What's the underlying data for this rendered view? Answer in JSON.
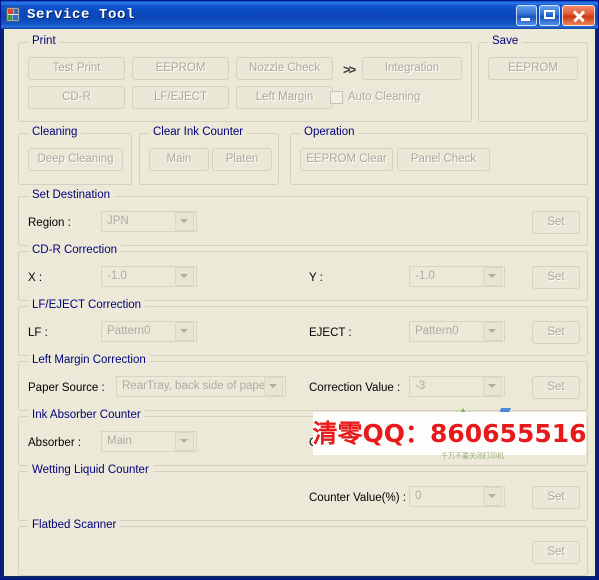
{
  "window": {
    "title": "Service Tool",
    "icon": "printer-app-icon",
    "buttons": {
      "minimize": "minimize-button",
      "maximize": "maximize-button",
      "close": "close-button"
    }
  },
  "groups": {
    "print": {
      "label": "Print",
      "buttons": [
        {
          "label": "Test Print"
        },
        {
          "label": "EEPROM"
        },
        {
          "label": "Nozzle Check"
        },
        {
          "label": "Integration"
        },
        {
          "label": "CD-R"
        },
        {
          "label": "LF/EJECT"
        },
        {
          "label": "Left Margin"
        }
      ],
      "separator": ">>",
      "checkbox": {
        "label": "Auto Cleaning",
        "checked": false
      }
    },
    "save": {
      "label": "Save",
      "buttons": [
        {
          "label": "EEPROM"
        }
      ]
    },
    "cleaning": {
      "label": "Cleaning",
      "buttons": [
        {
          "label": "Deep Cleaning"
        }
      ]
    },
    "clear_ink_counter": {
      "label": "Clear Ink Counter",
      "buttons": [
        {
          "label": "Main"
        },
        {
          "label": "Platen"
        }
      ]
    },
    "operation": {
      "label": "Operation",
      "buttons": [
        {
          "label": "EEPROM Clear"
        },
        {
          "label": "Panel Check"
        }
      ]
    },
    "set_destination": {
      "label": "Set Destination",
      "field_label": "Region :",
      "value": "JPN",
      "set_label": "Set"
    },
    "cdr_correction": {
      "label": "CD-R Correction",
      "x_label": "X :",
      "x_value": "-1.0",
      "y_label": "Y :",
      "y_value": "-1.0",
      "set_label": "Set"
    },
    "lf_eject_correction": {
      "label": "LF/EJECT Correction",
      "lf_label": "LF :",
      "lf_value": "Pattern0",
      "eject_label": "EJECT :",
      "eject_value": "Pattern0",
      "set_label": "Set"
    },
    "left_margin_correction": {
      "label": "Left Margin Correction",
      "paper_source_label": "Paper Source :",
      "paper_source_value": "RearTray, back side of paper",
      "correction_value_label": "Correction Value :",
      "correction_value": "-3",
      "set_label": "Set"
    },
    "ink_absorber_counter": {
      "label": "Ink Absorber Counter",
      "absorber_label": "Absorber :",
      "absorber_value": "Main",
      "counter_label": "C"
    },
    "wetting_liquid_counter": {
      "label": "Wetting Liquid Counter",
      "counter_label": "Counter Value(%) :",
      "counter_value": "0",
      "set_label": "Set"
    },
    "flatbed_scanner": {
      "label": "Flatbed Scanner",
      "set_label": "Set"
    }
  },
  "watermark": {
    "text": "清零QQ：860655516",
    "color": "#e8191b",
    "subtext": "千万不要关闭打印机"
  },
  "colors": {
    "titlebar": "#0a49bd",
    "client_background": "#ece9d8",
    "group_label": "#00007a",
    "disabled_text": "#aca899"
  }
}
